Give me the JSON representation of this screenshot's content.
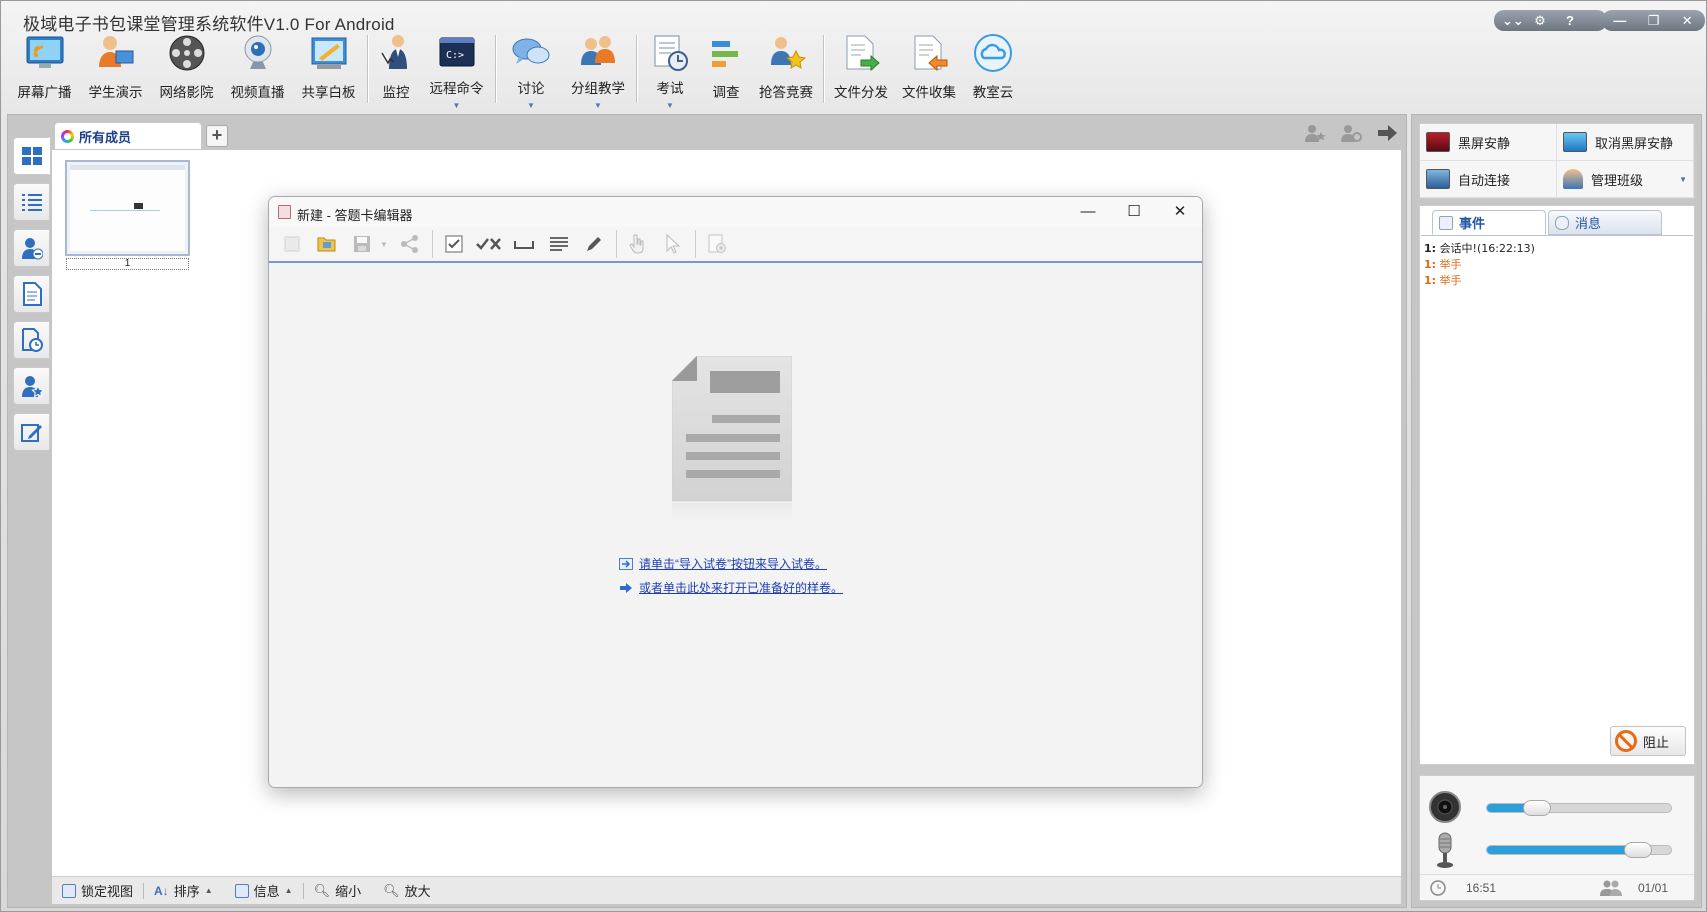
{
  "app": {
    "title": "极域电子书包课堂管理系统软件V1.0 For Android"
  },
  "window_controls": {
    "collapse_label": "⌄⌄",
    "settings_label": "⚙",
    "help_label": "?",
    "minimize_label": "—",
    "restore_label": "❐",
    "close_label": "✕"
  },
  "toolbar": {
    "items": [
      {
        "label": "屏幕广播",
        "icon": "screen-broadcast-icon"
      },
      {
        "label": "学生演示",
        "icon": "student-demo-icon"
      },
      {
        "label": "网络影院",
        "icon": "film-reel-icon"
      },
      {
        "label": "视频直播",
        "icon": "webcam-icon"
      },
      {
        "label": "共享白板",
        "icon": "whiteboard-icon"
      },
      {
        "label": "监控",
        "icon": "monitor-person-icon"
      },
      {
        "label": "远程命令",
        "icon": "command-prompt-icon"
      },
      {
        "label": "讨论",
        "icon": "chat-bubbles-icon"
      },
      {
        "label": "分组教学",
        "icon": "group-users-icon"
      },
      {
        "label": "考试",
        "icon": "exam-clock-icon"
      },
      {
        "label": "调查",
        "icon": "survey-bars-icon"
      },
      {
        "label": "抢答竞赛",
        "icon": "quiz-star-icon"
      },
      {
        "label": "文件分发",
        "icon": "file-send-icon"
      },
      {
        "label": "文件收集",
        "icon": "file-collect-icon"
      },
      {
        "label": "教室云",
        "icon": "cloud-icon"
      }
    ]
  },
  "tabs": {
    "all_members": "所有成员",
    "add": "+"
  },
  "thumbnail": {
    "label": "1"
  },
  "bottom_bar": {
    "lock_view": "锁定视图",
    "sort": "排序",
    "info": "信息",
    "zoom_out": "缩小",
    "zoom_in": "放大"
  },
  "right_actions": {
    "black_screen": "黑屏安静",
    "cancel_black_screen": "取消黑屏安静",
    "auto_connect": "自动连接",
    "manage_class": "管理班级"
  },
  "event_tabs": {
    "events": "事件",
    "messages": "消息"
  },
  "events": [
    {
      "index": "1:",
      "text": "会话中!(16:22:13)",
      "color": "#222222"
    },
    {
      "index": "1:",
      "text": "举手",
      "color": "#e06a1a"
    },
    {
      "index": "1:",
      "text": "举手",
      "color": "#e06a1a"
    }
  ],
  "stop_button": "阻止",
  "media": {
    "speaker_volume": 0.27,
    "mic_volume": 0.82
  },
  "status": {
    "time": "16:51",
    "count": "01/01"
  },
  "dialog": {
    "title": "新建 - 答题卡编辑器",
    "link_import": "请单击“导入试卷”按钮来导入试卷。",
    "link_open_sample": "或者单击此处来打开已准备好的样卷。"
  }
}
